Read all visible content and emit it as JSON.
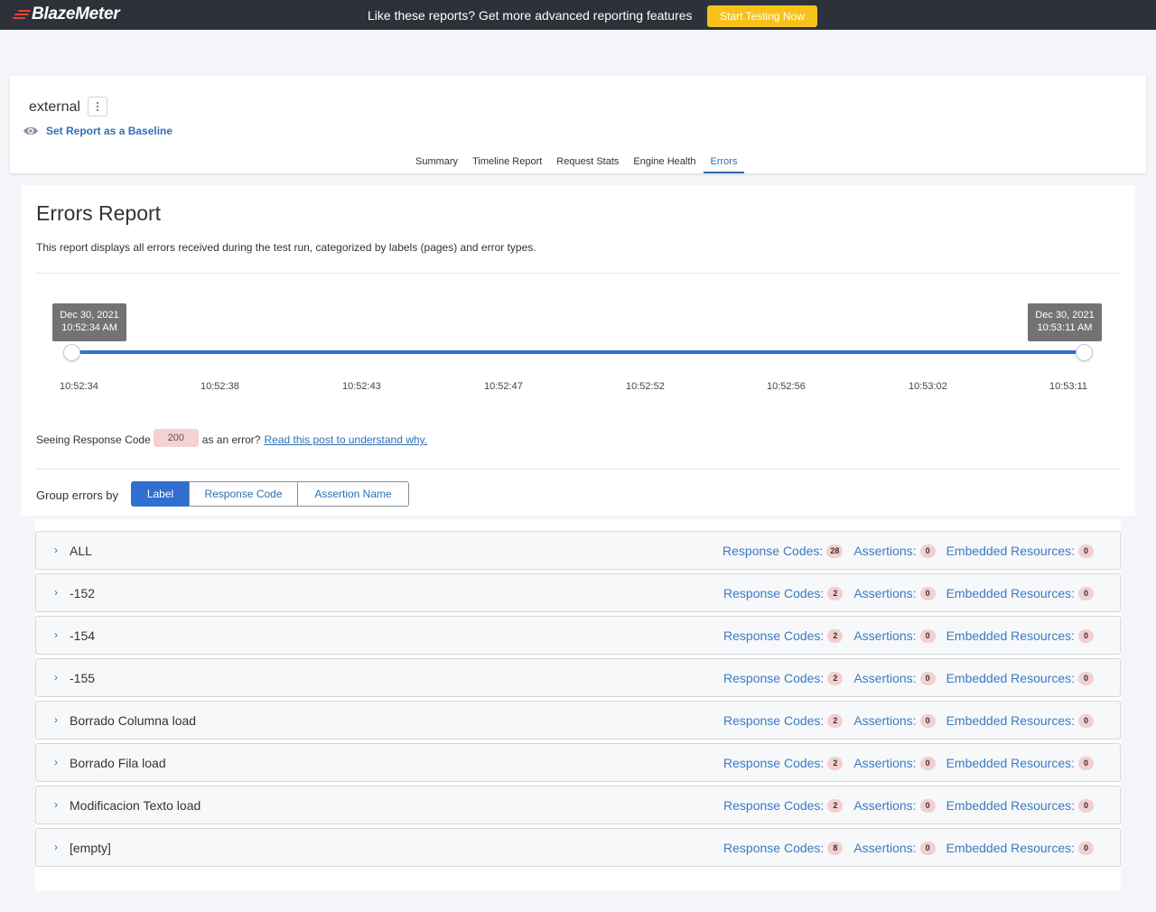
{
  "topbar": {
    "logo": "BlazeMeter",
    "promo": "Like these reports? Get more advanced reporting features",
    "cta": "Start Testing Now"
  },
  "header": {
    "report_name": "external",
    "baseline_link": "Set Report as a Baseline",
    "tabs": [
      "Summary",
      "Timeline Report",
      "Request Stats",
      "Engine Health",
      "Errors"
    ],
    "active_tab": "Errors"
  },
  "errors": {
    "title": "Errors Report",
    "description": "This report displays all errors received during the test run, categorized by labels (pages) and error types.",
    "range_start": {
      "date": "Dec 30, 2021",
      "time": "10:52:34 AM"
    },
    "range_end": {
      "date": "Dec 30, 2021",
      "time": "10:53:11 AM"
    },
    "ticks": [
      "10:52:34",
      "10:52:38",
      "10:52:43",
      "10:52:47",
      "10:52:52",
      "10:52:56",
      "10:53:02",
      "10:53:11"
    ],
    "response_code_note": {
      "prefix": "Seeing Response Code",
      "code": "200",
      "suffix": "as an error?",
      "link": "Read this post to understand why."
    },
    "group_by": {
      "label": "Group errors by",
      "options": [
        "Label",
        "Response Code",
        "Assertion Name"
      ],
      "selected": "Label"
    },
    "stat_labels": {
      "response_codes": "Response Codes:",
      "assertions": "Assertions:",
      "embedded": "Embedded Resources:"
    },
    "rows": [
      {
        "label": "ALL",
        "response_codes": "28",
        "assertions": "0",
        "embedded": "0"
      },
      {
        "label": "-152",
        "response_codes": "2",
        "assertions": "0",
        "embedded": "0"
      },
      {
        "label": "-154",
        "response_codes": "2",
        "assertions": "0",
        "embedded": "0"
      },
      {
        "label": "-155",
        "response_codes": "2",
        "assertions": "0",
        "embedded": "0"
      },
      {
        "label": "Borrado Columna load",
        "response_codes": "2",
        "assertions": "0",
        "embedded": "0"
      },
      {
        "label": "Borrado Fila load",
        "response_codes": "2",
        "assertions": "0",
        "embedded": "0"
      },
      {
        "label": "Modificacion Texto load",
        "response_codes": "2",
        "assertions": "0",
        "embedded": "0"
      },
      {
        "label": "[empty]",
        "response_codes": "8",
        "assertions": "0",
        "embedded": "0"
      }
    ]
  },
  "colors": {
    "topbar": "#2d3139",
    "accent": "#2f6fcf",
    "link": "#2f6fb5",
    "cta": "#f6c11b",
    "badge": "#f4cfcf"
  },
  "icons": [
    "blazemeter-logo-icon",
    "kebab-menu-icon",
    "baseline-eye-icon",
    "chevron-right-icon"
  ]
}
